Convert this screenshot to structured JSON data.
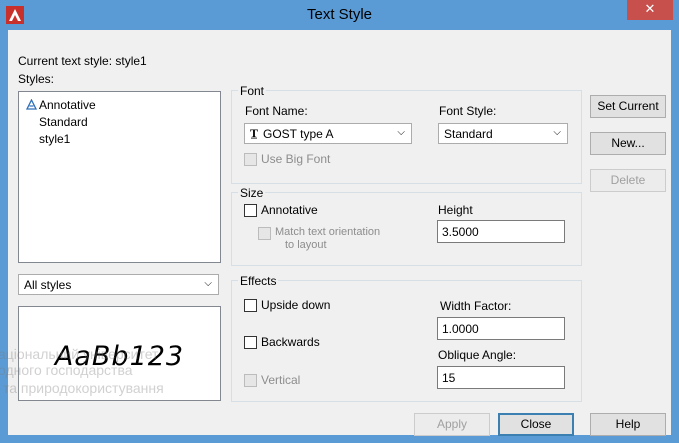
{
  "window": {
    "title": "Text Style",
    "close_glyph": "✕"
  },
  "current_style": "Current text style:  style1",
  "styles_label": "Styles:",
  "styles_list": [
    {
      "label": "Annotative",
      "icon": "annotative-icon"
    },
    {
      "label": "Standard"
    },
    {
      "label": "style1"
    }
  ],
  "filter": {
    "value": "All styles"
  },
  "preview": {
    "text": "AaBb123"
  },
  "watermark": {
    "line1": "аціональний університет",
    "line2": "одного господарства",
    "line3": "та природокористування"
  },
  "font": {
    "group": "Font",
    "name_label": "Font Name:",
    "name_value": "GOST type A",
    "name_icon": "truetype-icon",
    "style_label": "Font Style:",
    "style_value": "Standard",
    "big_font": "Use Big Font"
  },
  "size": {
    "group": "Size",
    "annotative": "Annotative",
    "match": "Match text orientation",
    "match2": "to layout",
    "height_label": "Height",
    "height_value": "3.5000"
  },
  "effects": {
    "group": "Effects",
    "upside_down": "Upside down",
    "backwards": "Backwards",
    "vertical": "Vertical",
    "width_label": "Width Factor:",
    "width_value": "1.0000",
    "oblique_label": "Oblique Angle:",
    "oblique_value": "15"
  },
  "buttons": {
    "set_current": "Set Current",
    "new": "New...",
    "delete": "Delete",
    "apply": "Apply",
    "close": "Close",
    "help": "Help"
  },
  "colors": {
    "title_bar": "#5b9bd5",
    "close_button": "#c74f4c",
    "app_icon": "#c8302c"
  }
}
